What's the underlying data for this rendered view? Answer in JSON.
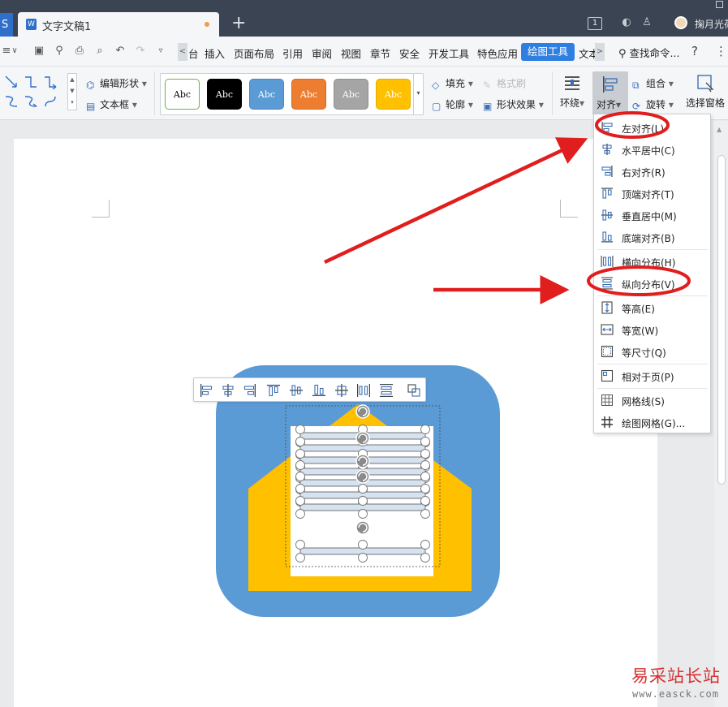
{
  "titlebar": {
    "app_button": "S",
    "doc_tab_title": "文字文稿1",
    "doc_tab_icon": "W",
    "new_tab": "+",
    "window_badge": "1",
    "user_name": "掬月光荷"
  },
  "menubar": {
    "scroll_left": "<",
    "items": {
      "partial": "台",
      "insert": "插入",
      "page_layout": "页面布局",
      "references": "引用",
      "review": "审阅",
      "view": "视图",
      "section": "章节",
      "security": "安全",
      "developer": "开发工具",
      "special": "特色应用",
      "drawing_tools": "绘图工具",
      "text_partial": "文本"
    },
    "scroll_right": ">",
    "search": "查找命令...",
    "help": "?",
    "more": "⋮"
  },
  "ribbon": {
    "edit_shape": "编辑形状",
    "text_box": "文本框",
    "style_sample_text": "Abc",
    "styles": [
      {
        "bg": "#ffffff",
        "border": "#6ab04c",
        "fg": "#000000"
      },
      {
        "bg": "#000000",
        "border": "#000000",
        "fg": "#ffffff"
      },
      {
        "bg": "#5b9bd5",
        "border": "#4a86c1",
        "fg": "#ffffff"
      },
      {
        "bg": "#ed7d31",
        "border": "#d46a22",
        "fg": "#ffffff"
      },
      {
        "bg": "#a5a5a5",
        "border": "#8f8f8f",
        "fg": "#ffffff"
      },
      {
        "bg": "#ffc000",
        "border": "#e6ac00",
        "fg": "#ffffff"
      }
    ],
    "fill": "填充",
    "format_brush": "格式刷",
    "outline": "轮廓",
    "shape_effects": "形状效果",
    "wrap": "环绕",
    "align": "对齐",
    "group": "组合",
    "rotate": "旋转",
    "selection_pane": "选择窗格"
  },
  "align_menu": {
    "items": [
      {
        "label": "左对齐(L)",
        "icon": "align-left-icon"
      },
      {
        "label": "水平居中(C)",
        "icon": "align-center-icon"
      },
      {
        "label": "右对齐(R)",
        "icon": "align-right-icon"
      },
      {
        "label": "顶端对齐(T)",
        "icon": "align-top-icon"
      },
      {
        "label": "垂直居中(M)",
        "icon": "align-middle-icon"
      },
      {
        "label": "底端对齐(B)",
        "icon": "align-bottom-icon"
      },
      {
        "label": "横向分布(H)",
        "icon": "distribute-horizontal-icon"
      },
      {
        "label": "纵向分布(V)",
        "icon": "distribute-vertical-icon"
      },
      {
        "label": "等高(E)",
        "icon": "equal-height-icon"
      },
      {
        "label": "等宽(W)",
        "icon": "equal-width-icon"
      },
      {
        "label": "等尺寸(Q)",
        "icon": "equal-size-icon"
      },
      {
        "label": "相对于页(P)",
        "icon": "relative-to-page-icon"
      },
      {
        "label": "网格线(S)",
        "icon": "gridlines-icon"
      },
      {
        "label": "绘图网格(G)...",
        "icon": "drawing-grid-icon"
      }
    ]
  },
  "colors": {
    "accent": "#2f7fe3",
    "envelope_background": "#5b9bd5",
    "envelope_body": "#ffc000",
    "annotation_red": "#e01e1e"
  },
  "watermark": {
    "title": "易采站长站",
    "url": "www.easck.com"
  }
}
